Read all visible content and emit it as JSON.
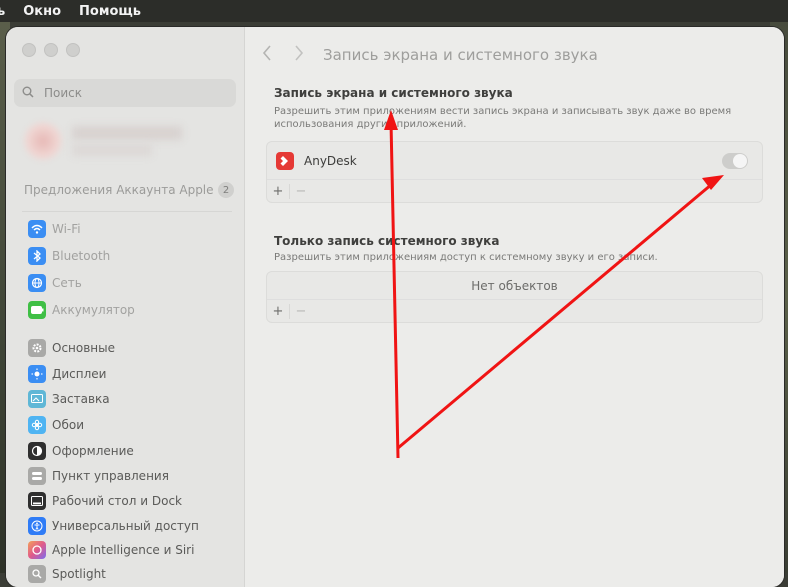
{
  "menubar": {
    "items": [
      "ь",
      "Окно",
      "Помощь"
    ]
  },
  "sidebar": {
    "search_placeholder": "Поиск",
    "suggestions_label": "Предложения Аккаунта Apple",
    "suggestions_count": "2",
    "items": [
      {
        "label": "Wi-Fi",
        "icon": "wifi-icon",
        "color": "#3b8ef3"
      },
      {
        "label": "Bluetooth",
        "icon": "bluetooth-icon",
        "color": "#3b8ef3"
      },
      {
        "label": "Сеть",
        "icon": "globe-icon",
        "color": "#3b8ef3"
      },
      {
        "label": "Аккумулятор",
        "icon": "battery-icon",
        "color": "#3fbf45"
      },
      {
        "label": "Основные",
        "icon": "gear-icon",
        "color": "#a9a9a7"
      },
      {
        "label": "Дисплеи",
        "icon": "sun-icon",
        "color": "#3b8ef3"
      },
      {
        "label": "Заставка",
        "icon": "screensaver-icon",
        "color": "#5fb7d6"
      },
      {
        "label": "Обои",
        "icon": "flower-icon",
        "color": "#4fb4f2"
      },
      {
        "label": "Оформление",
        "icon": "appearance-icon",
        "color": "#2f2f2f"
      },
      {
        "label": "Пункт управления",
        "icon": "control-center-icon",
        "color": "#a9a9a7"
      },
      {
        "label": "Рабочий стол и Dock",
        "icon": "dock-icon",
        "color": "#2f2f2f"
      },
      {
        "label": "Универсальный доступ",
        "icon": "accessibility-icon",
        "color": "#2f7cf6"
      },
      {
        "label": "Apple Intelligence и Siri",
        "icon": "siri-icon",
        "color": "#e0707a"
      },
      {
        "label": "Spotlight",
        "icon": "spotlight-icon",
        "color": "#a9a9a7"
      }
    ]
  },
  "content": {
    "page_title": "Запись экрана и системного звука",
    "section1": {
      "title": "Запись экрана и системного звука",
      "description": "Разрешить этим приложениям вести запись экрана и записывать звук даже во время использования других приложений.",
      "apps": [
        {
          "name": "AnyDesk",
          "enabled": true,
          "icon": "anydesk-icon"
        }
      ],
      "add": "+",
      "remove": "−"
    },
    "section2": {
      "title": "Только запись системного звука",
      "description": "Разрешить этим приложениям доступ к системному звуку и его записи.",
      "empty": "Нет объектов",
      "add": "+",
      "remove": "−"
    }
  },
  "colors": {
    "annotation_arrow": "#f01414",
    "anydesk_red": "#e53935"
  }
}
